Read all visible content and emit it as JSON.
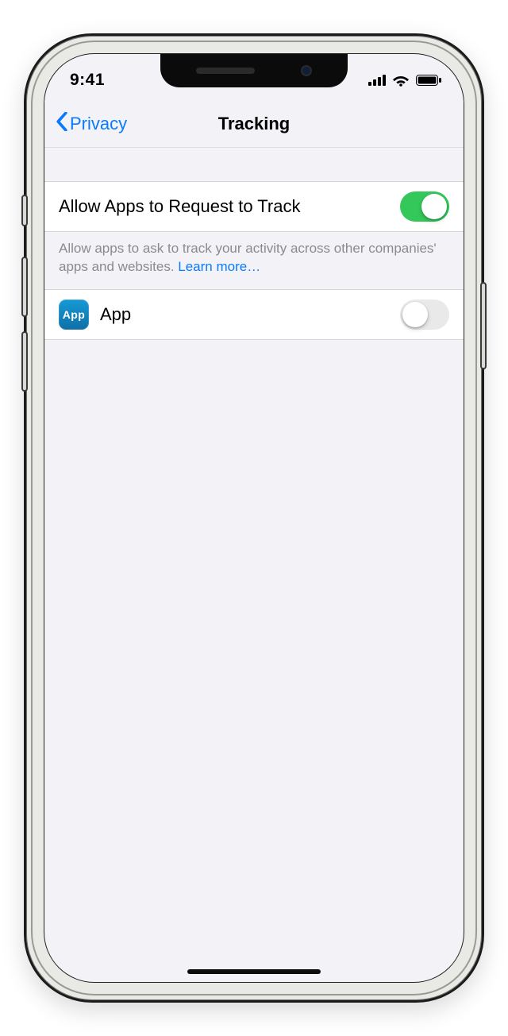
{
  "status": {
    "time": "9:41"
  },
  "nav": {
    "back_label": "Privacy",
    "title": "Tracking"
  },
  "settings": {
    "allow_label": "Allow Apps to Request to Track",
    "allow_on": true,
    "explain_text": "Allow apps to ask to track your activity across other companies' apps and websites. ",
    "learn_more": "Learn more…"
  },
  "apps": [
    {
      "icon_text": "App",
      "name": "App",
      "tracking_on": false
    }
  ]
}
